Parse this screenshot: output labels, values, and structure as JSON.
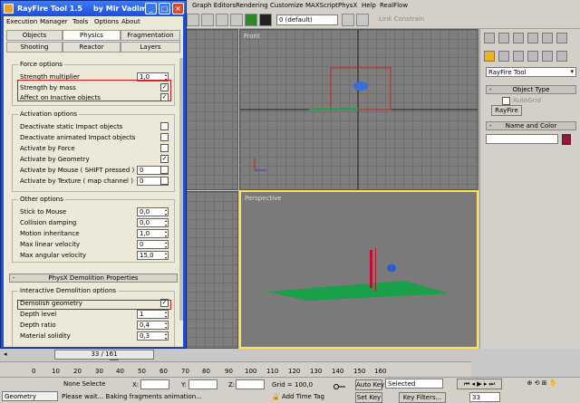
{
  "max": {
    "menu": [
      "Graph Editors",
      "Rendering",
      "Customize",
      "MAXScript",
      "PhysX",
      "Help",
      "RealFlow"
    ],
    "layer_value": "0 (default)",
    "link_constrain": "Link Constrain",
    "viewports": {
      "front": "Front",
      "perspective": "Perspective"
    }
  },
  "command_panel": {
    "dropdown": "RayFire Tool",
    "object_type": "Object Type",
    "autogrid": "AutoGrid",
    "rayfire_button": "RayFire",
    "name_and_color": "Name and Color",
    "color_swatch": "#a0123c"
  },
  "rayfire": {
    "title": "RayFire Tool 1.5",
    "author": "by Mir Vadim",
    "menu": [
      "Execution",
      "Manager",
      "Tools",
      "Options",
      "About"
    ],
    "tabs_row1": [
      "Objects",
      "Physics",
      "Fragmentation"
    ],
    "tabs_row2": [
      "Shooting",
      "Reactor",
      "Layers"
    ],
    "active_tab": "Physics",
    "force_options": {
      "title": "Force options",
      "strength_multiplier": {
        "label": "Strength multiplier",
        "value": "1,0"
      },
      "strength_by_mass": {
        "label": "Strength by mass",
        "checked": true
      },
      "affect_inactive": {
        "label": "Affect on Inactive objects",
        "checked": true
      }
    },
    "activation_options": {
      "title": "Activation options",
      "items": [
        {
          "label": "Deactivate static Impact objects",
          "checked": false
        },
        {
          "label": "Deactivate animated Impact objects",
          "checked": false
        },
        {
          "label": "Activate by Force",
          "checked": false
        },
        {
          "label": "Activate by Geometry",
          "checked": true
        }
      ],
      "by_mouse": {
        "label": "Activate by Mouse ( SHIFT pressed )",
        "value": "0"
      },
      "by_texture": {
        "label": "Activate by Texture ( map channel )",
        "value": "0"
      }
    },
    "other_options": {
      "title": "Other options",
      "items": [
        {
          "label": "Stick to Mouse",
          "value": "0,0"
        },
        {
          "label": "Collision damping",
          "value": "0,0"
        },
        {
          "label": "Motion inheritance",
          "value": "1,0"
        },
        {
          "label": "Max linear velocity",
          "value": "0"
        },
        {
          "label": "Max angular velocity",
          "value": "15,0"
        }
      ]
    },
    "physx_rollout": "PhysX Demolition Properties",
    "interactive_demolition": {
      "title": "Interactive Demolition options",
      "demolish_geometry": {
        "label": "Demolish geometry",
        "checked": true
      },
      "items": [
        {
          "label": "Depth level",
          "value": "1"
        },
        {
          "label": "Depth ratio",
          "value": "0,4"
        },
        {
          "label": "Material solidity",
          "value": "0,3"
        }
      ]
    }
  },
  "timeline": {
    "slider_label": "33 / 161",
    "ticks": [
      "0",
      "10",
      "20",
      "30",
      "40",
      "50",
      "60",
      "70",
      "80",
      "90",
      "100",
      "110",
      "120",
      "130",
      "140",
      "150",
      "160"
    ]
  },
  "status": {
    "geometry": "Geometry",
    "selection": "None Selecte",
    "x_label": "X:",
    "y_label": "Y:",
    "z_label": "Z:",
    "grid": "Grid = 100,0",
    "auto_key": "Auto Key",
    "selected": "Selected",
    "set_key": "Set Key",
    "key_filters": "Key Filters...",
    "frame": "33",
    "prompt": "Please wait... Baking fragments animation...",
    "add_time_tag": "Add Time Tag"
  }
}
